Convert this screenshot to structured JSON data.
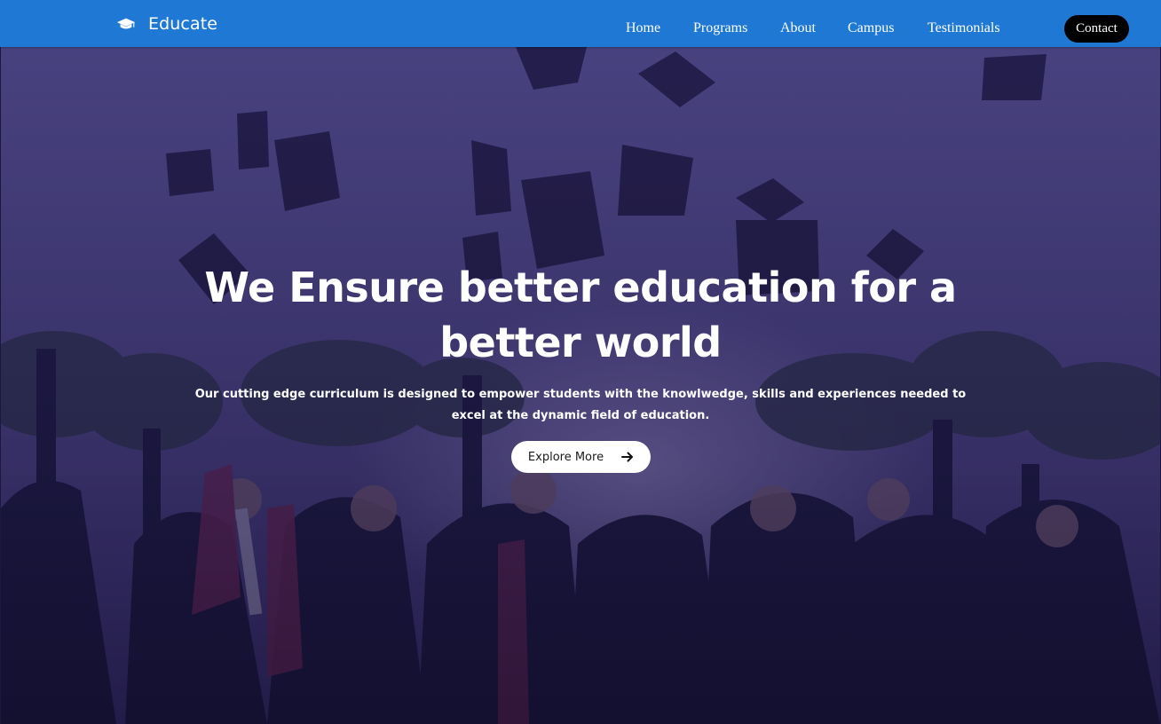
{
  "brand": {
    "name": "Educate",
    "icon": "graduation-cap-icon"
  },
  "nav": {
    "links": [
      "Home",
      "Programs",
      "About",
      "Campus",
      "Testimonials"
    ],
    "contact_label": "Contact"
  },
  "hero": {
    "title_lines": [
      "We Ensure better education for a",
      "better world"
    ],
    "subtitle_lines": [
      "Our cutting edge curriculum is designed to empower students with the knowlwedge, skills and experiences needed to",
      "excel at the dynamic field of education."
    ],
    "cta_label": "Explore More",
    "cta_icon": "arrow-right-icon",
    "background": "graduation-caps-photo"
  },
  "colors": {
    "navbar": "#1f79d4",
    "contact_button": "#000000",
    "overlay": "#28206a",
    "text": "#ffffff"
  }
}
